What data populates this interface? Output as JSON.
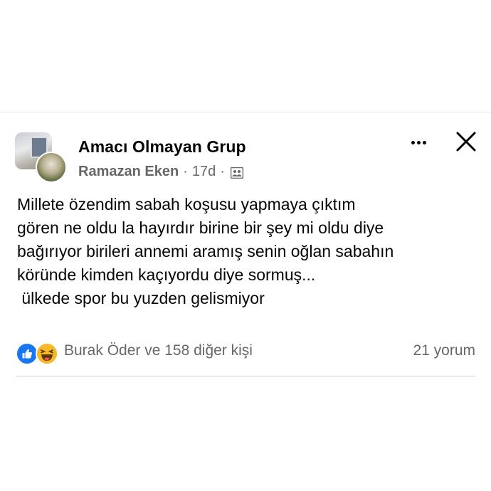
{
  "header": {
    "group_name": "Amacı Olmayan Grup",
    "author": "Ramazan Eken",
    "separator": "·",
    "time": "17d",
    "privacy_icon": "group-privacy-icon"
  },
  "actions": {
    "more_icon": "more-horizontal-icon",
    "close_icon": "close-icon"
  },
  "post": {
    "lines": [
      "Millete özendim sabah koşusu yapmaya çıktım",
      "gören ne oldu la hayırdır birine bir şey mi oldu diye",
      "bağırıyor birileri annemi aramış senin oğlan sabahın",
      "köründe kimden kaçıyordu diye sormuş...",
      " ülkede spor bu yuzden gelismiyor"
    ]
  },
  "reactions": {
    "icons": [
      "like-reaction-icon",
      "haha-reaction-icon"
    ],
    "summary": "Burak Öder ve 158 diğer kişi",
    "comments": "21 yorum"
  },
  "colors": {
    "primary_text": "#050505",
    "secondary_text": "#65676b",
    "like_blue": "#1877f2",
    "haha_yellow": "#f7b928",
    "divider": "#ced0d4"
  }
}
